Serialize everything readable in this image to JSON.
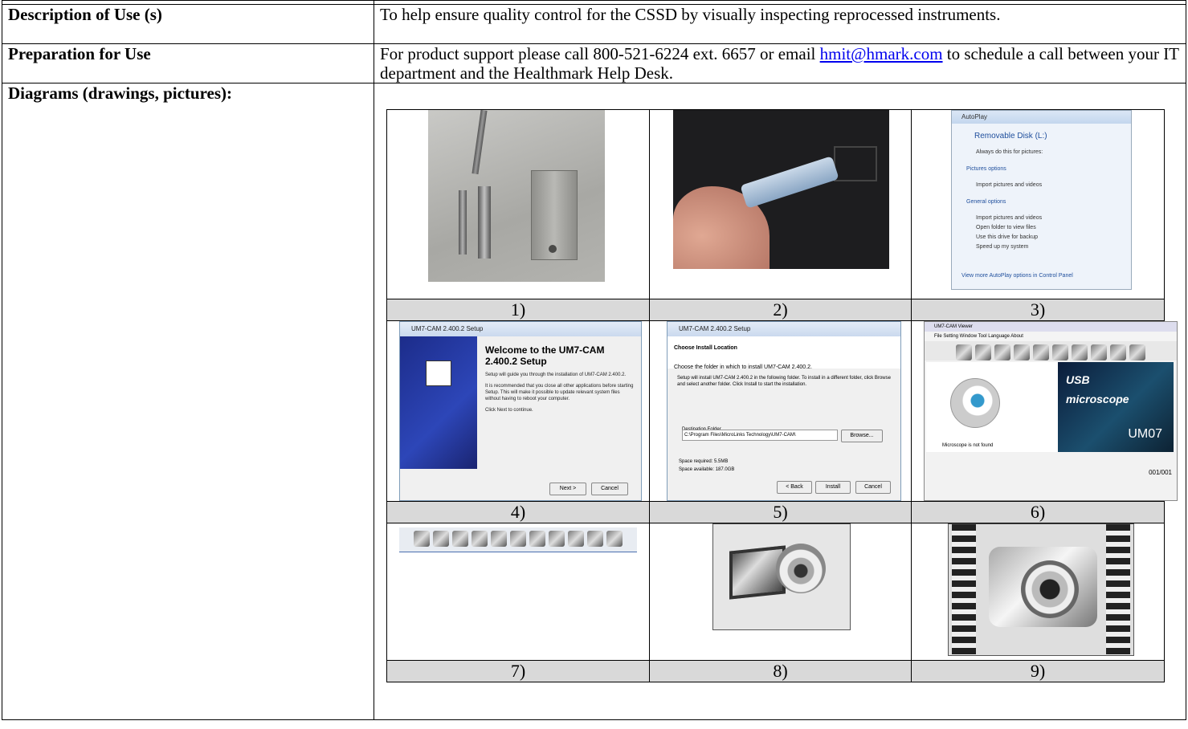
{
  "rows": {
    "description": {
      "label": "Description of Use (s)",
      "text": "To help ensure quality control for the CSSD by visually inspecting reprocessed instruments."
    },
    "preparation": {
      "label": "Preparation for Use",
      "text_before": "For product support please call 800-521-6224 ext. 6657 or email ",
      "email": "hmit@hmark.com",
      "text_after": " to schedule a call between your IT department and the Healthmark Help Desk."
    },
    "diagrams": {
      "label": "Diagrams (drawings, pictures):"
    }
  },
  "figures": {
    "captions": [
      "1)",
      "2)",
      "3)",
      "4)",
      "5)",
      "6)",
      "7)",
      "8)",
      "9)"
    ],
    "autoplay": {
      "title": "AutoPlay",
      "drive": "Removable Disk (L:)",
      "always": "Always do this for pictures:",
      "pictures_options": "Pictures options",
      "import1": "Import pictures and videos",
      "general_options": "General options",
      "import2": "Import pictures and videos",
      "open_folder": "Open folder to view files",
      "backup": "Use this drive for backup",
      "speed": "Speed up my system",
      "more": "View more AutoPlay options in Control Panel"
    },
    "setup_welcome": {
      "title": "UM7-CAM 2.400.2 Setup",
      "heading": "Welcome to the UM7-CAM 2.400.2 Setup",
      "body1": "Setup will guide you through the installation of UM7-CAM 2.400.2.",
      "body2": "It is recommended that you close all other applications before starting Setup. This will make it possible to update relevant system files without having to reboot your computer.",
      "body3": "Click Next to continue.",
      "next": "Next >",
      "cancel": "Cancel"
    },
    "setup_location": {
      "title": "UM7-CAM 2.400.2 Setup",
      "heading": "Choose Install Location",
      "sub": "Choose the folder in which to install UM7-CAM 2.400.2.",
      "body": "Setup will install UM7-CAM 2.400.2 in the following folder. To install in a different folder, click Browse and select another folder. Click Install to start the installation.",
      "dest_label": "Destination Folder",
      "path": "C:\\Program Files\\MicroLinks Technology\\UM7-CAM\\",
      "browse": "Browse...",
      "space_req": "Space required: 5.5MB",
      "space_avail": "Space available: 187.0GB",
      "back": "< Back",
      "install": "Install",
      "cancel": "Cancel"
    },
    "viewer": {
      "title": "UM7-CAM Viewer",
      "menu": "File  Setting  Window  Tool  Language  About",
      "brand1": "USB",
      "brand2": "microscope",
      "model": "UM07",
      "status": "Microscope is not found",
      "counter": "001/001"
    }
  }
}
